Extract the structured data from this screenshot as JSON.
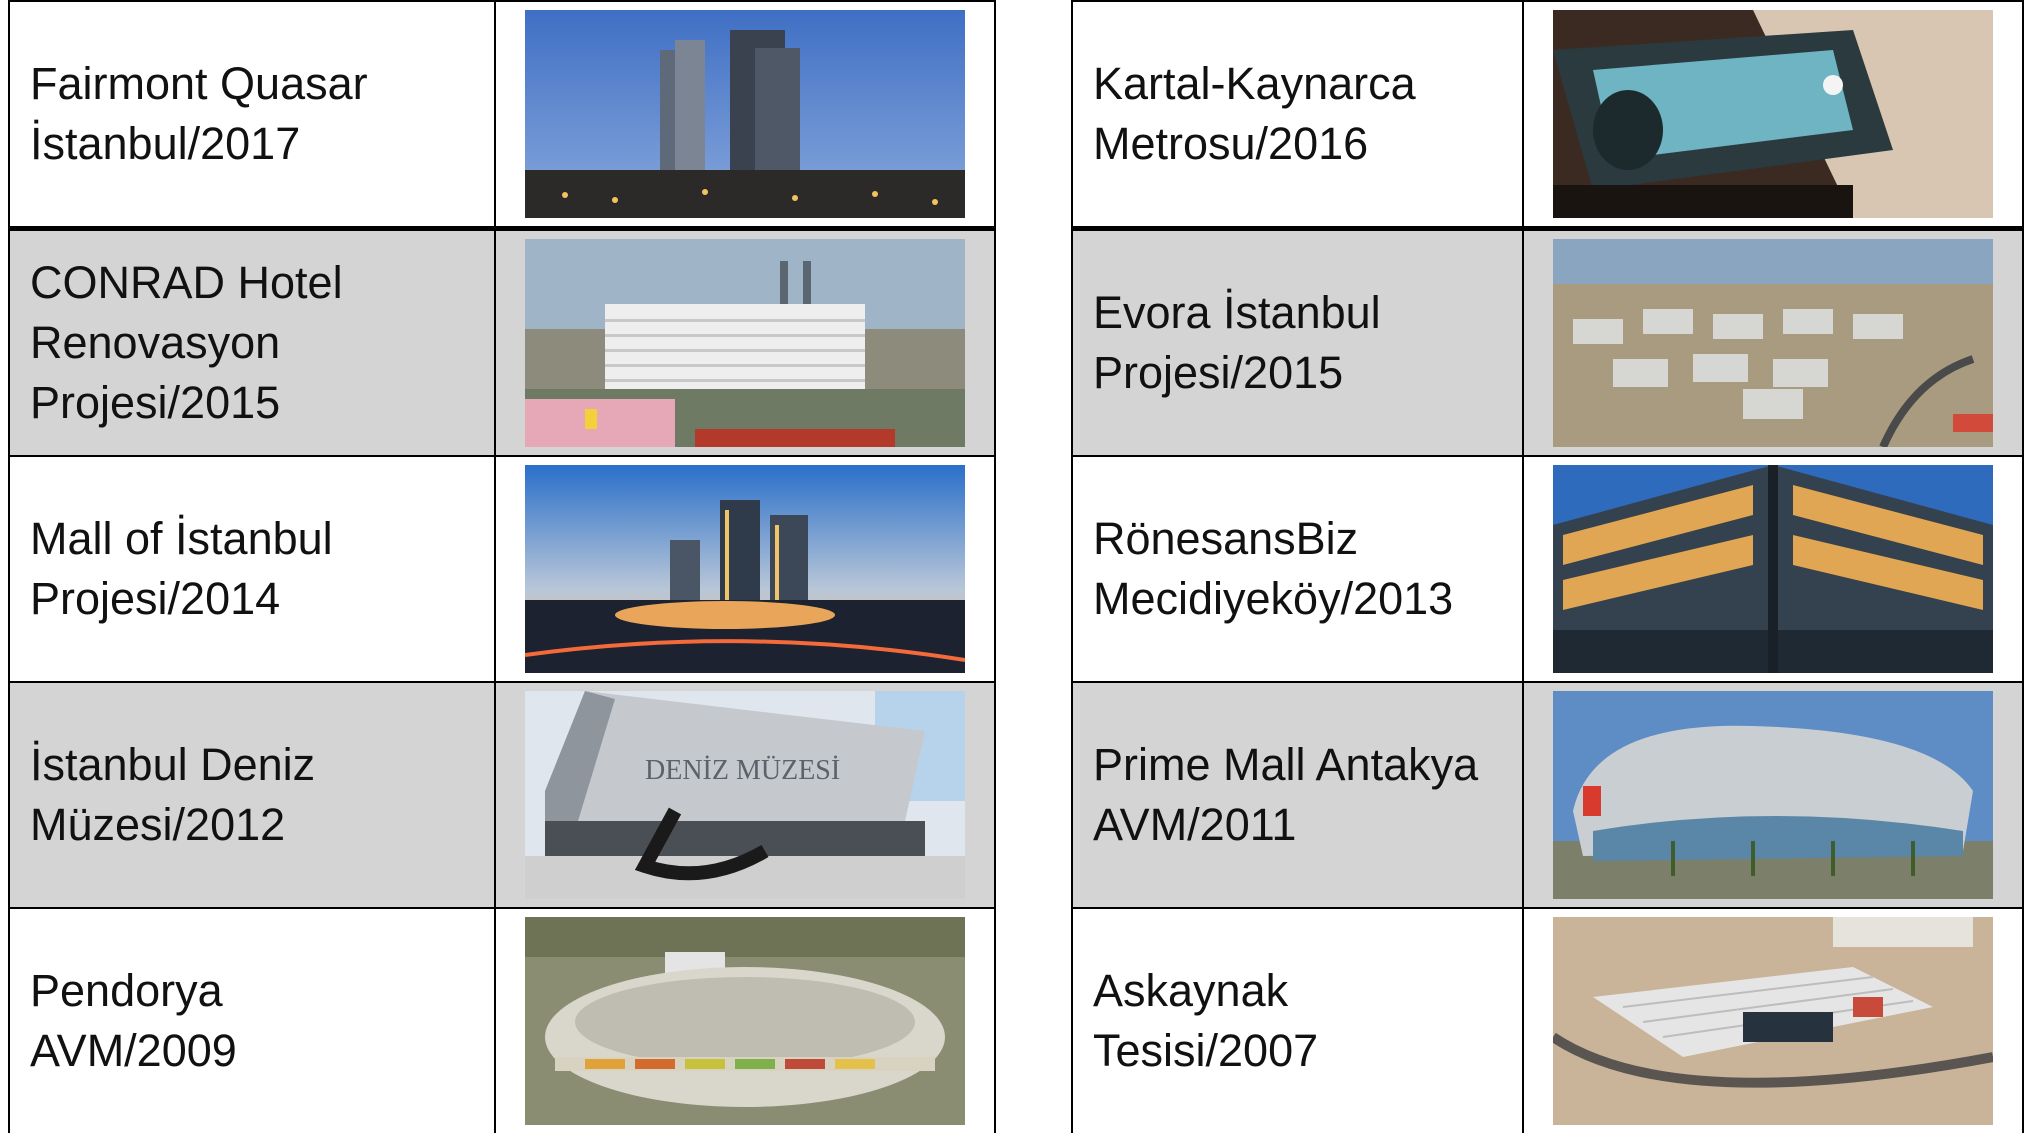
{
  "left_column": [
    {
      "label": "Fairmont Quasar\nİstanbul/2017",
      "shaded": false,
      "photo": "twin-tower-hotel-photo"
    },
    {
      "label": "CONRAD Hotel\nRenovasyon\nProjesi/2015",
      "shaded": true,
      "photo": "hotel-bridge-photo"
    },
    {
      "label": "Mall of İstanbul\nProjesi/2014",
      "shaded": false,
      "photo": "mall-towers-dusk-photo"
    },
    {
      "label": "İstanbul Deniz\nMüzesi/2012",
      "shaded": true,
      "photo": "maritime-museum-photo",
      "photo_sign": "DENİZ MÜZESİ"
    },
    {
      "label": "Pendorya\nAVM/2009",
      "shaded": false,
      "photo": "oval-mall-aerial-photo"
    }
  ],
  "right_column": [
    {
      "label": "Kartal-Kaynarca\nMetrosu/2016",
      "shaded": false,
      "photo": "metro-train-photo"
    },
    {
      "label": "Evora İstanbul\nProjesi/2015",
      "shaded": true,
      "photo": "residential-complex-aerial-photo"
    },
    {
      "label": "RönesansBiz\nMecidiyeköy/2013",
      "shaded": false,
      "photo": "glass-office-building-photo"
    },
    {
      "label": "Prime Mall Antakya\nAVM/2011",
      "shaded": true,
      "photo": "curved-mall-photo"
    },
    {
      "label": "Askaynak\nTesisi/2007",
      "shaded": false,
      "photo": "industrial-facility-aerial-photo"
    }
  ],
  "colors": {
    "shade": "#d4d4d4",
    "border": "#000000",
    "text": "#111111"
  }
}
